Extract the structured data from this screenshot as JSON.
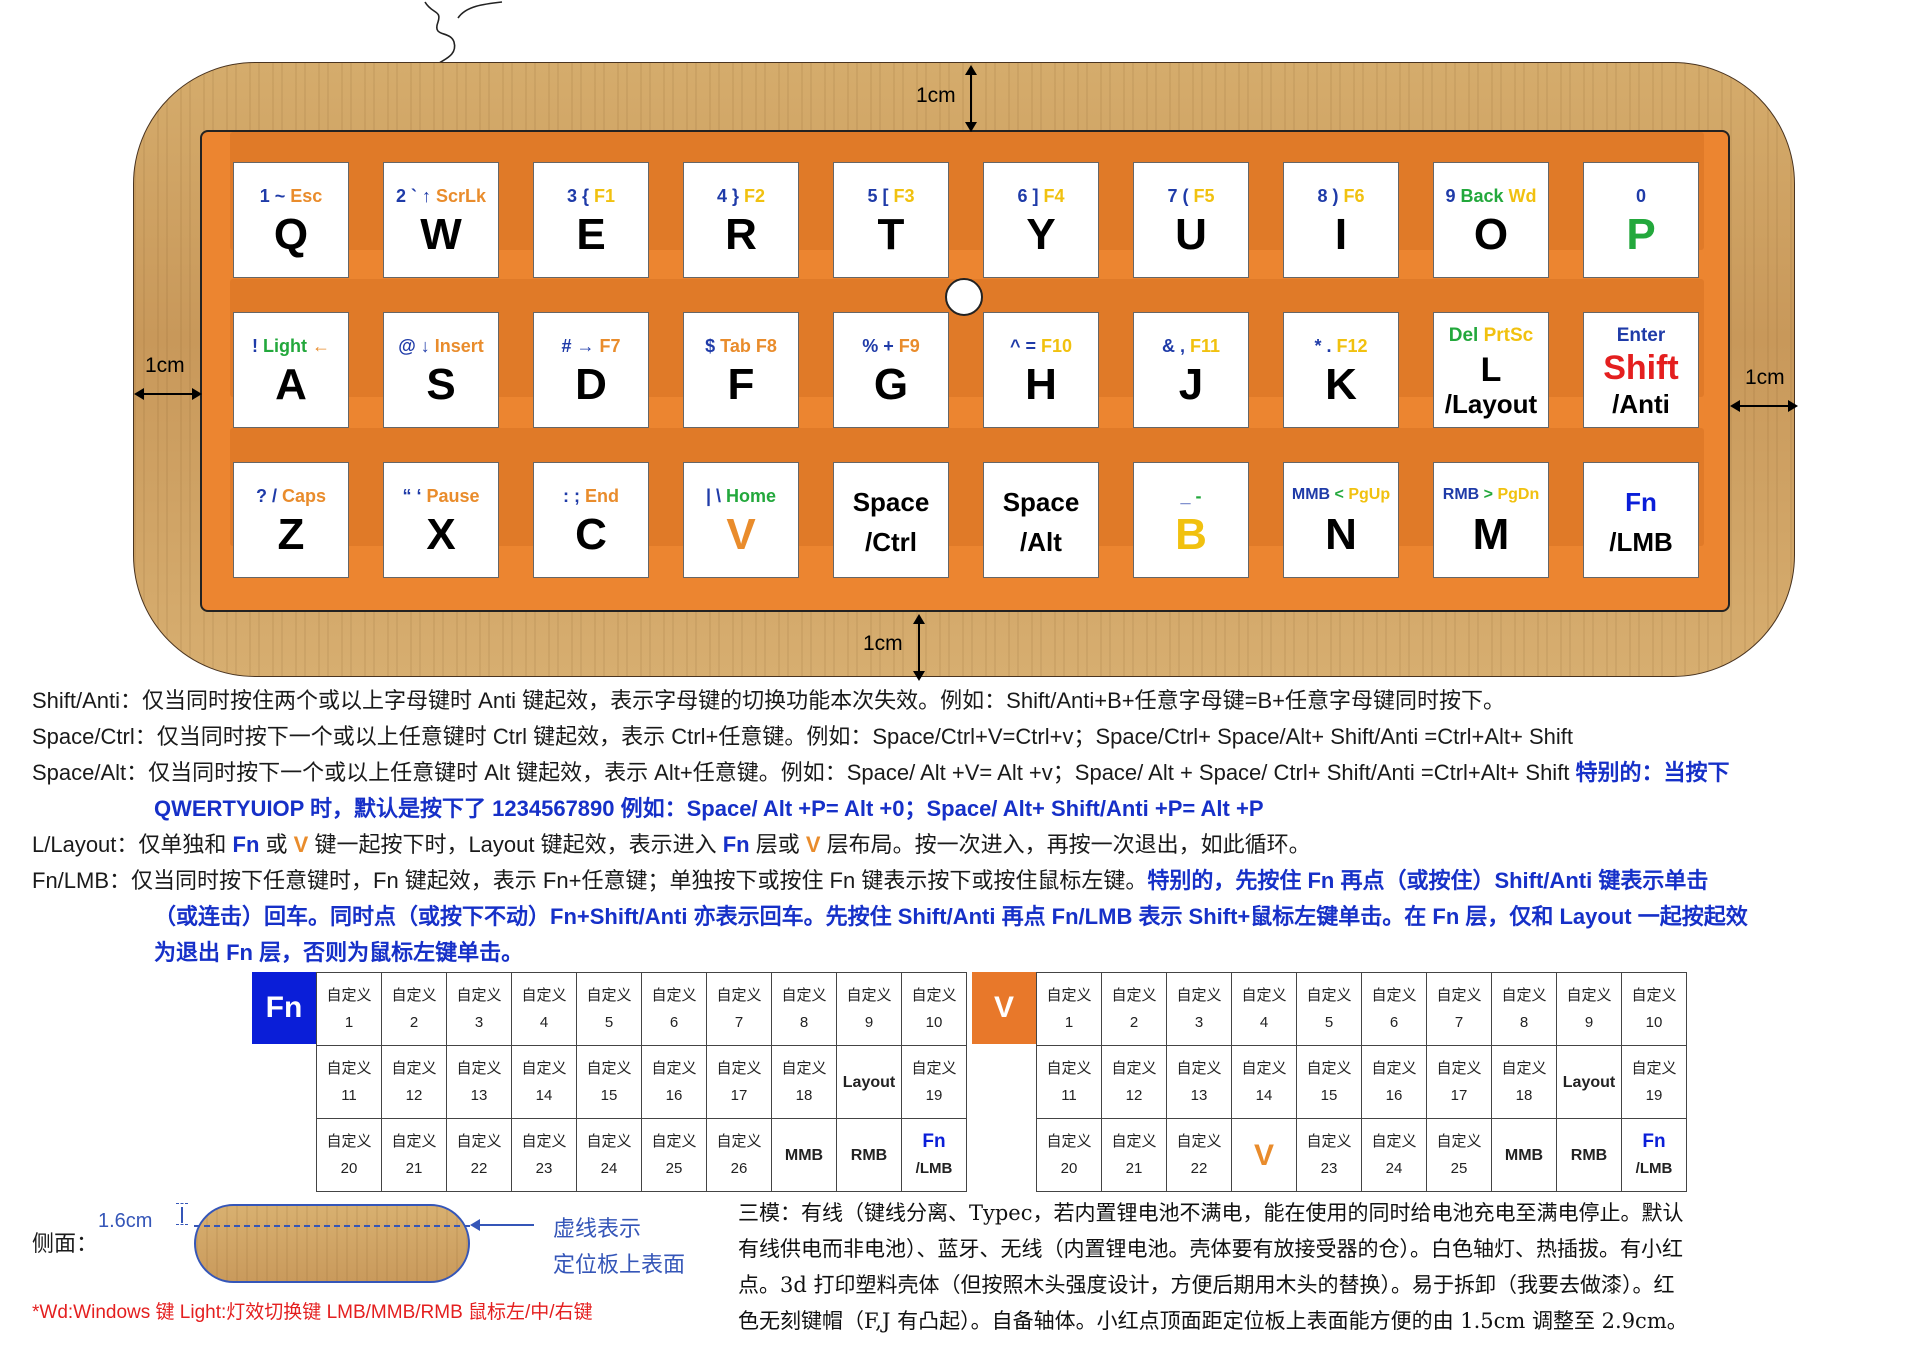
{
  "dims": {
    "top": "1cm",
    "bottom": "1cm",
    "left": "1cm",
    "right": "1cm",
    "side_height": "1.6cm"
  },
  "keys_row1": [
    {
      "top": [
        [
          "1 ~ ",
          "blue"
        ],
        [
          "Esc",
          "orange"
        ]
      ],
      "main": "Q"
    },
    {
      "top": [
        [
          "2 ` ↑ ",
          "blue"
        ],
        [
          "ScrLk",
          "orange"
        ]
      ],
      "main": "W"
    },
    {
      "top": [
        [
          "3 { ",
          "blue"
        ],
        [
          "F1",
          "yellow"
        ]
      ],
      "main": "E"
    },
    {
      "top": [
        [
          "4 } ",
          "blue"
        ],
        [
          "F2",
          "yellow"
        ]
      ],
      "main": "R"
    },
    {
      "top": [
        [
          "5 [ ",
          "blue"
        ],
        [
          "F3",
          "yellow"
        ]
      ],
      "main": "T"
    },
    {
      "top": [
        [
          "6 ] ",
          "blue"
        ],
        [
          "F4",
          "yellow"
        ]
      ],
      "main": "Y"
    },
    {
      "top": [
        [
          "7 ( ",
          "blue"
        ],
        [
          "F5",
          "yellow"
        ]
      ],
      "main": "U"
    },
    {
      "top": [
        [
          "8 ) ",
          "blue"
        ],
        [
          "F6",
          "yellow"
        ]
      ],
      "main": "I"
    },
    {
      "top": [
        [
          "9 ",
          "blue"
        ],
        [
          "Back ",
          "green"
        ],
        [
          "Wd",
          "yellow"
        ]
      ],
      "main": "O"
    },
    {
      "top": [
        [
          "0",
          "blue"
        ]
      ],
      "main": "P",
      "main_color": "green"
    }
  ],
  "keys_row2": [
    {
      "top": [
        [
          "! ",
          "blue"
        ],
        [
          "Light ",
          "green"
        ],
        [
          "←",
          "orange"
        ]
      ],
      "main": "A"
    },
    {
      "top": [
        [
          "@ ↓ ",
          "blue"
        ],
        [
          "Insert",
          "orange"
        ]
      ],
      "main": "S"
    },
    {
      "top": [
        [
          "# → ",
          "blue"
        ],
        [
          "F7",
          "orange"
        ]
      ],
      "main": "D"
    },
    {
      "top": [
        [
          "$ ",
          "blue"
        ],
        [
          "Tab ",
          "orange"
        ],
        [
          "F8",
          "orange"
        ]
      ],
      "main": "F"
    },
    {
      "top": [
        [
          "% + ",
          "blue"
        ],
        [
          "F9",
          "orange"
        ]
      ],
      "main": "G"
    },
    {
      "top": [
        [
          "^ = ",
          "blue"
        ],
        [
          "F10",
          "yellow"
        ]
      ],
      "main": "H"
    },
    {
      "top": [
        [
          "& , ",
          "blue"
        ],
        [
          "F11",
          "yellow"
        ]
      ],
      "main": "J"
    },
    {
      "top": [
        [
          "* . ",
          "blue"
        ],
        [
          "F12",
          "yellow"
        ]
      ],
      "main": "K"
    },
    {
      "special": "L",
      "line1": [
        [
          "Del ",
          "green"
        ],
        [
          "PrtSc",
          "yellow"
        ]
      ],
      "line2": "L",
      "line3": "/Layout"
    },
    {
      "special": "Shift",
      "line1": [
        [
          "Enter",
          "blue"
        ]
      ],
      "line2": "Shift",
      "line3": "/Anti"
    }
  ],
  "keys_row3": [
    {
      "top": [
        [
          "? / ",
          "blue"
        ],
        [
          "Caps",
          "orange"
        ]
      ],
      "main": "Z"
    },
    {
      "top": [
        [
          "“ ‘ ",
          "blue"
        ],
        [
          "Pause",
          "orange"
        ]
      ],
      "main": "X"
    },
    {
      "top": [
        [
          ": ; ",
          "blue"
        ],
        [
          "End",
          "orange"
        ]
      ],
      "main": "C"
    },
    {
      "top": [
        [
          "| \\ ",
          "blue"
        ],
        [
          "Home",
          "green"
        ]
      ],
      "main": "V",
      "main_color": "orange"
    },
    {
      "special": "two",
      "line1": "Space",
      "line2": "/Ctrl"
    },
    {
      "special": "two",
      "line1": "Space",
      "line2": "/Alt"
    },
    {
      "top": [
        [
          "_ ",
          "blue"
        ],
        [
          "-",
          "green"
        ]
      ],
      "main": "B",
      "main_color": "yellow"
    },
    {
      "top": [
        [
          "MMB ",
          "blue"
        ],
        [
          "< ",
          "green"
        ],
        [
          "PgUp",
          "yellow"
        ]
      ],
      "main": "N",
      "small": true
    },
    {
      "top": [
        [
          "RMB ",
          "blue"
        ],
        [
          "> ",
          "green"
        ],
        [
          "PgDn",
          "yellow"
        ]
      ],
      "main": "M",
      "small": true
    },
    {
      "special": "fn",
      "line1": "Fn",
      "line2": "/LMB"
    }
  ],
  "notes": {
    "shift": "Shift/Anti：仅当同时按住两个或以上字母键时 Anti 键起效，表示字母键的切换功能本次失效。例如：Shift/Anti+B+任意字母键=B+任意字母键同时按下。",
    "ctrl": "Space/Ctrl：仅当同时按下一个或以上任意键时 Ctrl 键起效，表示 Ctrl+任意键。例如：Space/Ctrl+V=Ctrl+v；Space/Ctrl+ Space/Alt+ Shift/Anti =Ctrl+Alt+ Shift",
    "alt": "Space/Alt：仅当同时按下一个或以上任意键时 Alt 键起效，表示 Alt+任意键。例如：Space/ Alt +V= Alt +v；Space/ Alt + Space/ Ctrl+ Shift/Anti =Ctrl+Alt+ Shift",
    "alt_special": "特别的：当按下",
    "alt_cont": "QWERTYUIOP 时，默认是按下了 1234567890 例如：Space/ Alt +P= Alt +0；Space/ Alt+ Shift/Anti +P= Alt +P",
    "layout_a": "L/Layout：仅单独和 ",
    "layout_fn": "Fn",
    "layout_b": " 或 ",
    "layout_v": "V",
    "layout_c": " 键一起按下时，Layout 键起效，表示进入 ",
    "layout_fn2": "Fn",
    "layout_d": " 层或 ",
    "layout_v2": "V",
    "layout_e": " 层布局。按一次进入，再按一次退出，如此循环。",
    "fn": "Fn/LMB：仅当同时按下任意键时，Fn 键起效，表示 Fn+任意键；单独按下或按住 Fn 键表示按下或按住鼠标左键。",
    "fn_special": "特别的，先按住 Fn 再点（或按住）Shift/Anti 键表示单击",
    "fn_cont1": "（或连击）回车。同时点（或按下不动）Fn+Shift/Anti 亦表示回车。先按住 Shift/Anti 再点 Fn/LMB 表示 Shift+鼠标左键单击。在 Fn 层，仅和 Layout 一起按起效",
    "fn_cont2": "为退出 Fn 层，否则为鼠标左键单击。"
  },
  "layer_fn": {
    "tag": "Fn",
    "row1": [
      "自定义|1",
      "自定义|2",
      "自定义|3",
      "自定义|4",
      "自定义|5",
      "自定义|6",
      "自定义|7",
      "自定义|8",
      "自定义|9",
      "自定义|10"
    ],
    "row2": [
      "",
      "自定义|11",
      "自定义|12",
      "自定义|13",
      "自定义|14",
      "自定义|15",
      "自定义|16",
      "自定义|17",
      "自定义|18",
      "Layout",
      "自定义|19"
    ],
    "row3": [
      "",
      "自定义|20",
      "自定义|21",
      "自定义|22",
      "自定义|23",
      "自定义|24",
      "自定义|25",
      "自定义|26",
      "MMB",
      "RMB",
      "Fn|/LMB"
    ]
  },
  "layer_v": {
    "tag": "V",
    "row1": [
      "自定义|1",
      "自定义|2",
      "自定义|3",
      "自定义|4",
      "自定义|5",
      "自定义|6",
      "自定义|7",
      "自定义|8",
      "自定义|9",
      "自定义|10"
    ],
    "row2": [
      "",
      "自定义|11",
      "自定义|12",
      "自定义|13",
      "自定义|14",
      "自定义|15",
      "自定义|16",
      "自定义|17",
      "自定义|18",
      "Layout",
      "自定义|19"
    ],
    "row3": [
      "",
      "自定义|20",
      "自定义|21",
      "自定义|22",
      "V",
      "自定义|23",
      "自定义|24",
      "自定义|25",
      "MMB",
      "RMB",
      "Fn|/LMB"
    ]
  },
  "side": {
    "label": "侧面：",
    "dash_note_1": "虚线表示",
    "dash_note_2": "定位板上表面"
  },
  "legend": "*Wd:Windows 键  Light:灯效切换键  LMB/MMB/RMB 鼠标左/中/右键",
  "paragraph": [
    "三模：有线（键线分离、Typec，若内置锂电池不满电，能在使用的同时给电池充电至满电停止。默认",
    "有线供电而非电池）、蓝牙、无线（内置锂电池。壳体要有放接受器的仓）。白色轴灯、热插拔。有小红",
    "点。3d 打印塑料壳体（但按照木头强度设计，方便后期用木头的替换）。易于拆卸（我要去做漆）。红",
    "色无刻键帽（F,J 有凸起）。自备轴体。小红点顶面距定位板上表面能方便的由 1.5cm 调整至 2.9cm。"
  ],
  "colors": {
    "blue": "#1f3ba8",
    "orange": "#e98c2c",
    "green": "#23a83c",
    "yellow": "#f1c10f",
    "red": "#e41f1f",
    "fn_tag": "#0a1ed8",
    "v_tag": "#e8782a"
  }
}
